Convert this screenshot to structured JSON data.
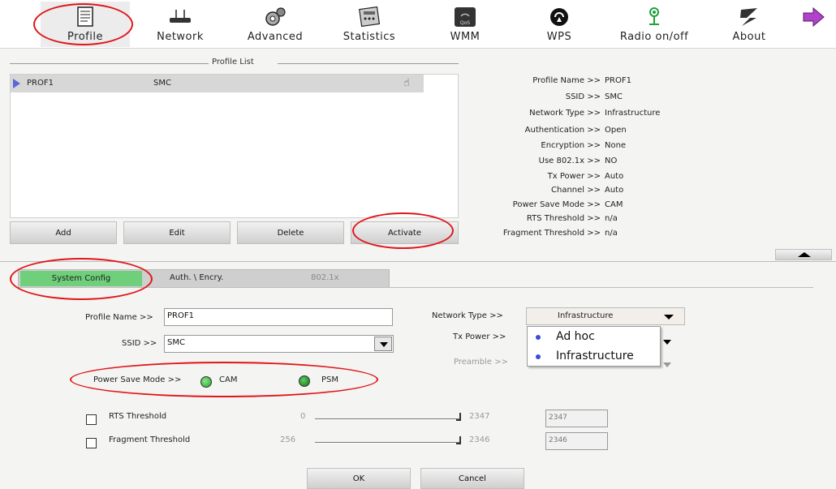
{
  "toolbar": {
    "items": [
      {
        "label": "Profile",
        "icon": "profile-icon"
      },
      {
        "label": "Network",
        "icon": "network-icon"
      },
      {
        "label": "Advanced",
        "icon": "advanced-icon"
      },
      {
        "label": "Statistics",
        "icon": "statistics-icon"
      },
      {
        "label": "WMM",
        "icon": "wmm-icon"
      },
      {
        "label": "WPS",
        "icon": "wps-icon"
      },
      {
        "label": "Radio on/off",
        "icon": "radio-icon"
      },
      {
        "label": "About",
        "icon": "about-icon"
      }
    ],
    "next_icon": "next-arrow-icon"
  },
  "profile_list": {
    "title": "Profile List",
    "rows": [
      {
        "name": "PROF1",
        "ssid": "SMC"
      }
    ],
    "buttons": {
      "add": "Add",
      "edit": "Edit",
      "delete": "Delete",
      "activate": "Activate"
    }
  },
  "profile_info": [
    {
      "key": "Profile Name >>",
      "value": "PROF1"
    },
    {
      "key": "SSID >>",
      "value": "SMC"
    },
    {
      "key": "Network Type >>",
      "value": "Infrastructure"
    },
    {
      "key": "Authentication >>",
      "value": "Open"
    },
    {
      "key": "Encryption >>",
      "value": "None"
    },
    {
      "key": "Use 802.1x >>",
      "value": "NO"
    },
    {
      "key": "Tx Power >>",
      "value": "Auto"
    },
    {
      "key": "Channel >>",
      "value": "Auto"
    },
    {
      "key": "Power Save Mode >>",
      "value": "CAM"
    },
    {
      "key": "RTS Threshold >>",
      "value": "n/a"
    },
    {
      "key": "Fragment Threshold >>",
      "value": "n/a"
    }
  ],
  "tabs": {
    "system_config": "System Config",
    "auth_encry": "Auth. \\ Encry.",
    "dot1x": "802.1x"
  },
  "form": {
    "profile_name_label": "Profile Name >>",
    "profile_name_value": "PROF1",
    "ssid_label": "SSID >>",
    "ssid_value": "SMC",
    "network_type_label": "Network Type >>",
    "network_type_value": "Infrastructure",
    "network_type_options": [
      "Ad hoc",
      "Infrastructure"
    ],
    "tx_power_label": "Tx Power >>",
    "preamble_label": "Preamble >>",
    "psm_label": "Power Save Mode >>",
    "psm_cam": "CAM",
    "psm_psm": "PSM",
    "rts_label": "RTS Threshold",
    "rts_min": "0",
    "rts_max": "2347",
    "rts_value": "2347",
    "frag_label": "Fragment Threshold",
    "frag_min": "256",
    "frag_max": "2346",
    "frag_value": "2346"
  },
  "footer": {
    "ok": "OK",
    "cancel": "Cancel"
  },
  "colors": {
    "highlight_oval": "#e0161b",
    "active_tab": "#6fcf7a",
    "radio_green": "#1e9f2a"
  }
}
